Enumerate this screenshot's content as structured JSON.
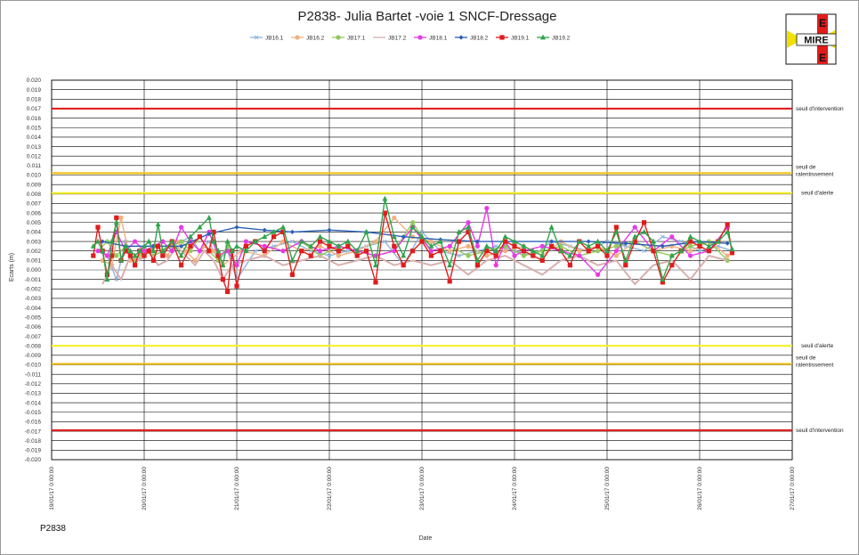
{
  "footer_label": "P2838",
  "logo": {
    "text_main": "MIRE",
    "text_top": "E",
    "text_bottom": "E"
  },
  "chart_data": {
    "type": "line",
    "title": "P2838- Julia Bartet -voie 1 SNCF-Dressage",
    "xlabel": "Date",
    "ylabel": "Ecarts (m)",
    "ylim": [
      -0.02,
      0.02
    ],
    "y_ticks": [
      "-0.020",
      "-0.019",
      "-0.018",
      "-0.017",
      "-0.016",
      "-0.015",
      "-0.014",
      "-0.013",
      "-0.012",
      "-0.011",
      "-0.010",
      "-0.009",
      "-0.008",
      "-0.007",
      "-0.006",
      "-0.005",
      "-0.004",
      "-0.003",
      "-0.002",
      "-0.001",
      "0.000",
      "0.001",
      "0.002",
      "0.003",
      "0.004",
      "0.005",
      "0.006",
      "0.007",
      "0.008",
      "0.009",
      "0.010",
      "0.011",
      "0.012",
      "0.013",
      "0.014",
      "0.015",
      "0.016",
      "0.017",
      "0.018",
      "0.019",
      "0.020"
    ],
    "x_ticks": [
      "19/01/17 0:00:00",
      "20/01/17 0:00:00",
      "21/01/17 0:00:00",
      "22/01/17 0:00:00",
      "23/01/17 0:00:00",
      "24/01/17 0:00:00",
      "25/01/17 0:00:00",
      "26/01/17 0:00:00",
      "27/01/17 0:00:00"
    ],
    "x_range_days": [
      0,
      8
    ],
    "legend_position": "top",
    "grid": true,
    "thresholds": [
      {
        "value": 0.017,
        "label": "seuil d'intervention",
        "color": "#e02020"
      },
      {
        "value": 0.0102,
        "label": "seuil de ralentissement",
        "color": "#f2c21b"
      },
      {
        "value": 0.0081,
        "label": "seuil d'alerte",
        "color": "#f5ef2a"
      },
      {
        "value": -0.008,
        "label": "seuil d'alerte",
        "color": "#f5ef2a"
      },
      {
        "value": -0.0099,
        "label": "seuil de ralentissement",
        "color": "#f2c21b"
      },
      {
        "value": -0.0169,
        "label": "seuil d'intervention",
        "color": "#e02020"
      }
    ],
    "series": [
      {
        "name": "JB16.1",
        "color": "#8fb4d8",
        "marker": "x",
        "x": [
          0.55,
          0.6,
          0.7,
          0.8,
          0.9,
          1.0,
          1.1,
          1.2,
          1.3,
          1.4,
          1.5,
          1.6,
          1.7,
          1.8,
          1.9,
          2.0,
          2.2,
          2.4,
          2.6,
          2.8,
          3.0,
          3.2,
          3.4,
          3.6,
          3.8,
          4.0,
          4.2,
          4.4,
          4.6,
          4.8,
          5.0,
          5.2,
          5.4,
          5.6,
          5.8,
          6.0,
          6.2,
          6.4,
          6.6,
          6.8,
          7.0,
          7.2,
          7.35
        ],
        "y": [
          0.002,
          0.0015,
          -0.001,
          0.003,
          0.0005,
          0.002,
          0.0015,
          0.002,
          0.0025,
          0.003,
          0.0035,
          0.002,
          0.003,
          0.001,
          0.002,
          -0.001,
          0.002,
          0.0025,
          0.003,
          0.002,
          0.0015,
          0.002,
          0.0025,
          0.003,
          0.0005,
          0.004,
          0.002,
          0.0015,
          0.002,
          0.0025,
          0.002,
          0.0015,
          0.003,
          0.0025,
          0.002,
          0.003,
          0.0025,
          0.002,
          0.0035,
          0.003,
          0.002,
          0.0025,
          0.002
        ]
      },
      {
        "name": "JB16.2",
        "color": "#f0b080",
        "marker": "circle",
        "x": [
          0.55,
          0.65,
          0.75,
          0.85,
          0.95,
          1.05,
          1.15,
          1.25,
          1.35,
          1.45,
          1.55,
          1.65,
          1.75,
          1.85,
          2.05,
          2.3,
          2.5,
          2.7,
          2.9,
          3.1,
          3.3,
          3.5,
          3.7,
          3.9,
          4.1,
          4.3,
          4.5,
          4.7,
          4.9,
          5.1,
          5.3,
          5.5,
          5.7,
          5.9,
          6.1,
          6.3,
          6.5,
          6.7,
          6.9,
          7.1,
          7.3
        ],
        "y": [
          0.001,
          0.0005,
          0.0055,
          0.001,
          0.0015,
          0.002,
          0.0025,
          0.0015,
          0.003,
          0.002,
          0.001,
          0.0025,
          0.002,
          0.0005,
          0.002,
          0.0015,
          0.003,
          0.002,
          0.0025,
          0.0015,
          0.002,
          0.003,
          0.0055,
          0.0035,
          0.003,
          0.002,
          0.0025,
          0.0015,
          0.002,
          0.0025,
          0.0015,
          0.003,
          0.002,
          0.0025,
          0.0015,
          0.003,
          0.002,
          0.0025,
          0.002,
          0.003,
          0.0015
        ]
      },
      {
        "name": "JB17.1",
        "color": "#92c95a",
        "marker": "circle",
        "x": [
          0.5,
          0.6,
          0.7,
          0.8,
          0.9,
          1.0,
          1.1,
          1.2,
          1.3,
          1.4,
          1.5,
          1.6,
          1.7,
          1.8,
          1.9,
          2.0,
          2.1,
          2.3,
          2.5,
          2.7,
          2.9,
          3.1,
          3.3,
          3.5,
          3.7,
          3.9,
          4.1,
          4.3,
          4.5,
          4.7,
          4.9,
          5.1,
          5.3,
          5.5,
          5.7,
          5.9,
          6.1,
          6.3,
          6.5,
          6.7,
          6.9,
          7.1,
          7.3
        ],
        "y": [
          0.002,
          0.003,
          0.0015,
          0.0025,
          0.001,
          0.002,
          0.0015,
          0.002,
          0.0025,
          0.003,
          0.002,
          0.0035,
          0.002,
          0.001,
          0.0025,
          0.0005,
          0.003,
          0.0025,
          0.002,
          0.003,
          0.0015,
          0.0025,
          0.002,
          0.0015,
          0.002,
          0.005,
          0.002,
          0.0025,
          0.0015,
          0.002,
          0.0025,
          0.0015,
          0.002,
          0.0025,
          0.0015,
          0.002,
          0.0025,
          0.003,
          0.002,
          0.0015,
          0.0025,
          0.003,
          0.001
        ]
      },
      {
        "name": "JB17.2",
        "color": "#d9b0b0",
        "marker": "none",
        "x": [
          0.55,
          0.65,
          0.75,
          0.85,
          0.95,
          1.05,
          1.15,
          1.25,
          1.35,
          1.45,
          1.55,
          1.65,
          1.75,
          1.85,
          1.95,
          2.1,
          2.3,
          2.5,
          2.7,
          2.9,
          3.1,
          3.3,
          3.5,
          3.7,
          3.9,
          4.1,
          4.3,
          4.5,
          4.7,
          4.9,
          5.1,
          5.3,
          5.5,
          5.7,
          5.9,
          6.1,
          6.3,
          6.5,
          6.7,
          6.9,
          7.1,
          7.3
        ],
        "y": [
          -0.0015,
          0.0005,
          -0.001,
          0.0015,
          0.001,
          0.002,
          0.0005,
          0.001,
          0.0025,
          0.0015,
          0.0005,
          0.002,
          0.001,
          -0.001,
          0.0005,
          0.001,
          0.0015,
          0.0005,
          0.001,
          0.0015,
          0.0005,
          0.001,
          0.0015,
          0.0005,
          0.001,
          0.0005,
          0.001,
          -0.0005,
          0.001,
          0.0015,
          0.0005,
          -0.0005,
          0.001,
          0.0015,
          0.0005,
          0.001,
          -0.0015,
          0.0005,
          0.001,
          -0.001,
          0.0015,
          0.001
        ]
      },
      {
        "name": "JB18.1",
        "color": "#e838e8",
        "marker": "circle",
        "x": [
          0.5,
          0.6,
          0.7,
          0.8,
          0.9,
          1.0,
          1.1,
          1.2,
          1.3,
          1.4,
          1.5,
          1.6,
          1.7,
          1.8,
          1.9,
          2.0,
          2.1,
          2.3,
          2.5,
          2.7,
          2.9,
          3.1,
          3.3,
          3.5,
          3.7,
          3.9,
          4.1,
          4.3,
          4.5,
          4.6,
          4.7,
          4.8,
          4.9,
          5.0,
          5.1,
          5.3,
          5.5,
          5.7,
          5.9,
          6.1,
          6.3,
          6.5,
          6.7,
          6.9,
          7.1,
          7.3
        ],
        "y": [
          0.002,
          0.0015,
          0.004,
          0.002,
          0.003,
          0.002,
          0.0025,
          0.003,
          0.002,
          0.0045,
          0.003,
          0.002,
          0.004,
          0.0015,
          0.002,
          0.0005,
          0.003,
          0.0025,
          0.002,
          0.003,
          0.002,
          0.0025,
          0.002,
          0.0015,
          0.002,
          0.0045,
          0.002,
          0.0025,
          0.005,
          0.0025,
          0.0065,
          0.0005,
          0.003,
          0.0015,
          0.002,
          0.0025,
          0.002,
          0.0015,
          -0.0005,
          0.002,
          0.0045,
          0.002,
          0.0035,
          0.0015,
          0.002,
          0.0045
        ]
      },
      {
        "name": "JB18.2",
        "color": "#2a5fb8",
        "marker": "diamond",
        "x": [
          0.55,
          0.8,
          1.1,
          1.4,
          1.7,
          2.0,
          2.3,
          2.6,
          3.0,
          3.4,
          3.8,
          4.2,
          4.6,
          5.0,
          5.4,
          5.8,
          6.2,
          6.6,
          7.0,
          7.3
        ],
        "y": [
          0.003,
          0.0025,
          0.0025,
          0.0025,
          0.0038,
          0.0045,
          0.0042,
          0.004,
          0.0042,
          0.004,
          0.0035,
          0.0032,
          0.003,
          0.003,
          0.003,
          0.003,
          0.0028,
          0.0025,
          0.003,
          0.0028
        ]
      },
      {
        "name": "JB19.1",
        "color": "#e01c1c",
        "marker": "square",
        "x": [
          0.45,
          0.5,
          0.55,
          0.6,
          0.65,
          0.7,
          0.75,
          0.8,
          0.85,
          0.9,
          0.95,
          1.0,
          1.05,
          1.1,
          1.15,
          1.2,
          1.3,
          1.4,
          1.5,
          1.6,
          1.7,
          1.75,
          1.8,
          1.85,
          1.9,
          1.95,
          2.0,
          2.1,
          2.2,
          2.3,
          2.4,
          2.5,
          2.6,
          2.7,
          2.8,
          2.9,
          3.0,
          3.1,
          3.2,
          3.3,
          3.4,
          3.5,
          3.6,
          3.7,
          3.8,
          3.9,
          4.0,
          4.1,
          4.2,
          4.3,
          4.4,
          4.5,
          4.6,
          4.7,
          4.8,
          4.9,
          5.0,
          5.1,
          5.2,
          5.3,
          5.4,
          5.5,
          5.6,
          5.7,
          5.8,
          5.9,
          6.0,
          6.1,
          6.2,
          6.3,
          6.4,
          6.5,
          6.6,
          6.7,
          6.8,
          6.9,
          7.0,
          7.1,
          7.2,
          7.3,
          7.35
        ],
        "y": [
          0.0015,
          0.0045,
          0.002,
          -0.0005,
          0.0015,
          0.0055,
          0.001,
          0.002,
          0.0015,
          0.0005,
          0.002,
          0.0015,
          0.002,
          0.001,
          0.0025,
          0.0015,
          0.003,
          0.0005,
          0.0025,
          0.0035,
          0.002,
          0.004,
          0.0015,
          -0.001,
          -0.0023,
          0.002,
          -0.0017,
          0.0025,
          0.003,
          0.002,
          0.0035,
          0.004,
          -0.0005,
          0.002,
          0.0015,
          0.003,
          0.0025,
          0.002,
          0.0025,
          0.0015,
          0.002,
          -0.0013,
          0.006,
          0.0025,
          0.0005,
          0.002,
          0.003,
          0.0015,
          0.002,
          -0.0012,
          0.003,
          0.004,
          0.0005,
          0.002,
          0.0015,
          0.003,
          0.0025,
          0.002,
          0.0015,
          0.001,
          0.0025,
          0.002,
          0.0005,
          0.003,
          0.002,
          0.0025,
          0.0015,
          0.0045,
          0.0005,
          0.003,
          0.005,
          0.002,
          -0.0013,
          0.0005,
          0.002,
          0.003,
          0.0025,
          0.002,
          0.003,
          0.0048,
          0.0018
        ]
      },
      {
        "name": "JB19.2",
        "color": "#2ea44a",
        "marker": "triangle",
        "x": [
          0.45,
          0.5,
          0.55,
          0.6,
          0.65,
          0.7,
          0.75,
          0.8,
          0.85,
          0.9,
          0.95,
          1.0,
          1.05,
          1.1,
          1.15,
          1.2,
          1.3,
          1.4,
          1.5,
          1.6,
          1.7,
          1.75,
          1.8,
          1.85,
          1.9,
          1.95,
          2.0,
          2.1,
          2.2,
          2.3,
          2.4,
          2.5,
          2.6,
          2.7,
          2.8,
          2.9,
          3.0,
          3.1,
          3.2,
          3.3,
          3.4,
          3.5,
          3.6,
          3.7,
          3.8,
          3.9,
          4.0,
          4.1,
          4.2,
          4.3,
          4.4,
          4.5,
          4.6,
          4.7,
          4.8,
          4.9,
          5.0,
          5.1,
          5.2,
          5.3,
          5.4,
          5.5,
          5.6,
          5.7,
          5.8,
          5.9,
          6.0,
          6.1,
          6.2,
          6.3,
          6.4,
          6.5,
          6.6,
          6.7,
          6.8,
          6.9,
          7.0,
          7.1,
          7.2,
          7.3,
          7.35
        ],
        "y": [
          0.0025,
          0.003,
          0.002,
          -0.001,
          0.003,
          0.005,
          0.001,
          0.0025,
          0.002,
          0.0015,
          0.002,
          0.0025,
          0.003,
          0.002,
          0.0048,
          0.002,
          0.003,
          0.0015,
          0.0035,
          0.0045,
          0.0055,
          0.003,
          0.002,
          0.0005,
          0.003,
          0.002,
          0.0025,
          0.002,
          0.003,
          0.0035,
          0.004,
          0.0045,
          0.001,
          0.003,
          0.0025,
          0.0035,
          0.003,
          0.0025,
          0.003,
          0.002,
          0.004,
          0.0005,
          0.0075,
          0.0035,
          0.0015,
          0.0045,
          0.0035,
          0.0025,
          0.003,
          0.0005,
          0.004,
          0.0045,
          0.001,
          0.0025,
          0.002,
          0.0035,
          0.003,
          0.0025,
          0.002,
          0.0015,
          0.0045,
          0.002,
          0.0015,
          0.003,
          0.0025,
          0.003,
          0.002,
          0.004,
          0.001,
          0.0035,
          0.004,
          0.003,
          -0.001,
          0.0015,
          0.002,
          0.0035,
          0.003,
          0.0025,
          0.003,
          0.004,
          0.0022
        ]
      }
    ]
  }
}
